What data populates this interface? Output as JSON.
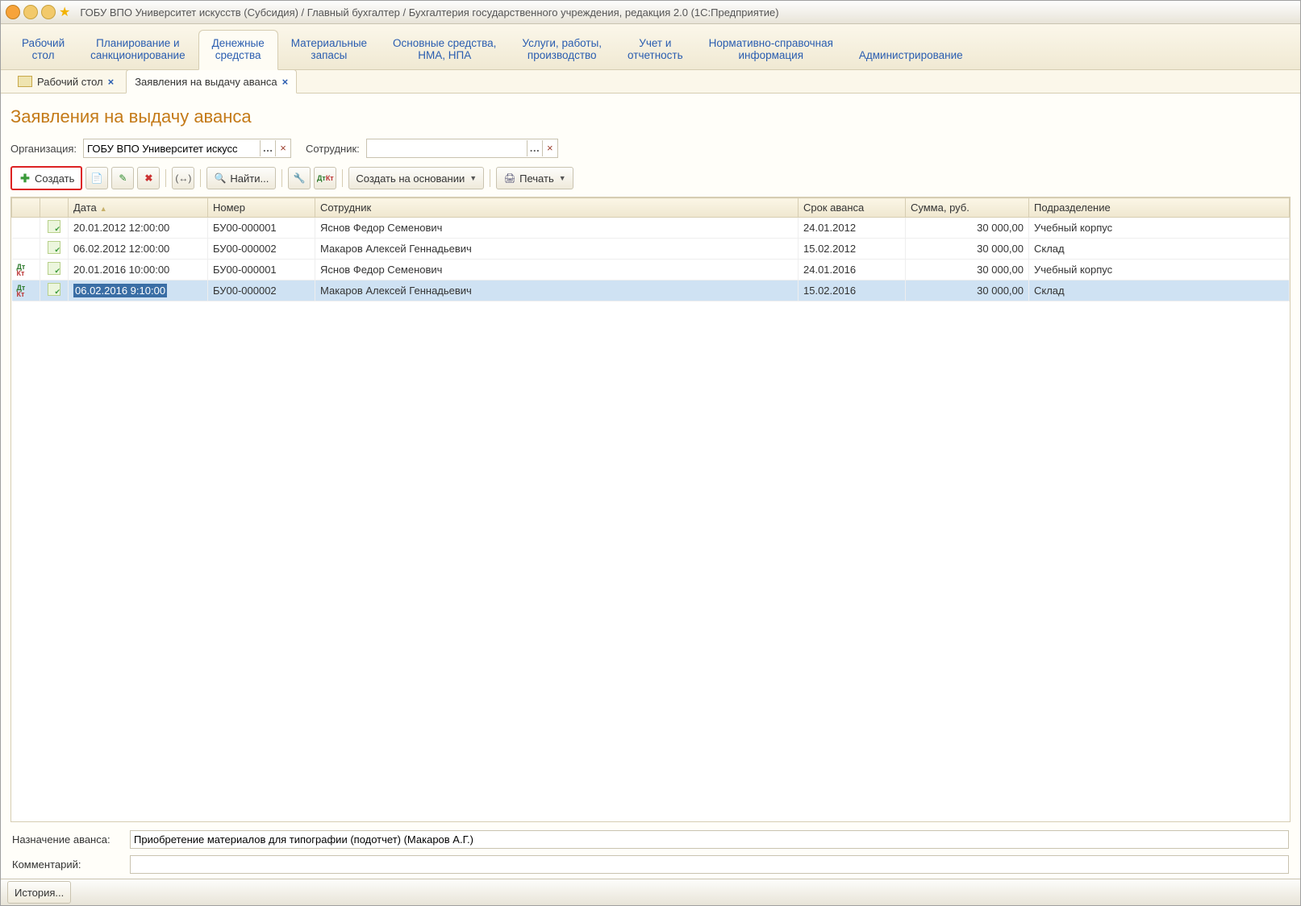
{
  "window": {
    "title": "ГОБУ ВПО Университет искусств (Субсидия) / Главный бухгалтер / Бухгалтерия государственного учреждения, редакция 2.0  (1С:Предприятие)"
  },
  "sections": [
    "Рабочий\nстол",
    "Планирование и\nсанкционирование",
    "Денежные\nсредства",
    "Материальные\nзапасы",
    "Основные средства,\nНМА, НПА",
    "Услуги, работы,\nпроизводство",
    "Учет и\nотчетность",
    "Нормативно-справочная\nинформация",
    "Администрирование"
  ],
  "active_section_index": 2,
  "doc_tabs": [
    {
      "label": "Рабочий стол",
      "active": false
    },
    {
      "label": "Заявления на выдачу аванса",
      "active": true
    }
  ],
  "page_title": "Заявления на выдачу аванса",
  "filters": {
    "org_label": "Организация:",
    "org_value": "ГОБУ ВПО Университет искусс",
    "emp_label": "Сотрудник:",
    "emp_value": ""
  },
  "toolbar": {
    "create": "Создать",
    "find": "Найти...",
    "create_based": "Создать на основании",
    "print": "Печать"
  },
  "grid": {
    "columns": [
      "",
      "",
      "Дата",
      "Номер",
      "Сотрудник",
      "Срок аванса",
      "Сумма, руб.",
      "Подразделение"
    ],
    "rows": [
      {
        "dk": false,
        "icon": "ok",
        "date": "20.01.2012 12:00:00",
        "num": "БУ00-000001",
        "emp": "Яснов Федор Семенович",
        "due": "24.01.2012",
        "sum": "30 000,00",
        "dept": "Учебный корпус",
        "selected": false
      },
      {
        "dk": false,
        "icon": "ok",
        "date": "06.02.2012 12:00:00",
        "num": "БУ00-000002",
        "emp": "Макаров Алексей Геннадьевич",
        "due": "15.02.2012",
        "sum": "30 000,00",
        "dept": "Склад",
        "selected": false
      },
      {
        "dk": true,
        "icon": "ok",
        "date": "20.01.2016 10:00:00",
        "num": "БУ00-000001",
        "emp": "Яснов Федор Семенович",
        "due": "24.01.2016",
        "sum": "30 000,00",
        "dept": "Учебный корпус",
        "selected": false
      },
      {
        "dk": true,
        "icon": "ok",
        "date": "06.02.2016 9:10:00",
        "num": "БУ00-000002",
        "emp": "Макаров Алексей Геннадьевич",
        "due": "15.02.2016",
        "sum": "30 000,00",
        "dept": "Склад",
        "selected": true
      }
    ]
  },
  "bottom": {
    "purpose_label": "Назначение аванса:",
    "purpose_value": "Приобретение материалов для типографии (подотчет) (Макаров А.Г.)",
    "comment_label": "Комментарий:",
    "comment_value": ""
  },
  "statusbar": {
    "history": "История..."
  }
}
